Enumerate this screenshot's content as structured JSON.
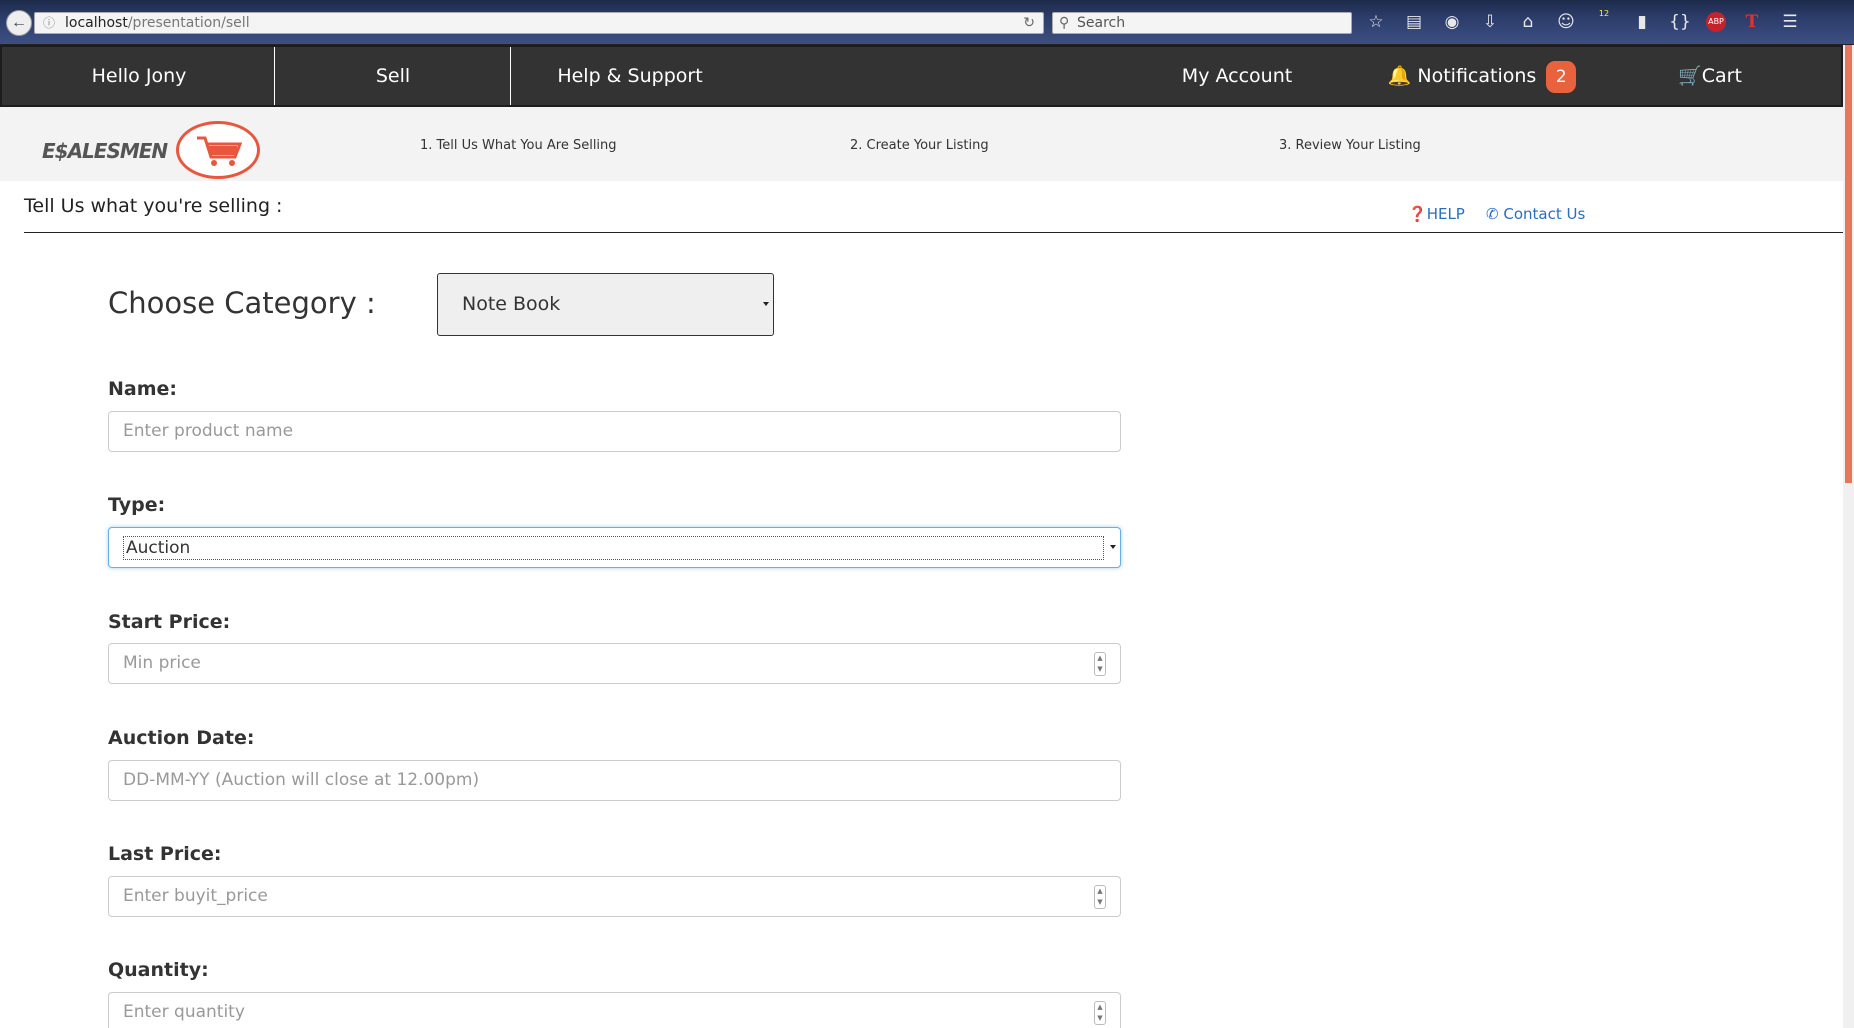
{
  "browser": {
    "url_host": "localhost",
    "url_path": "/presentation/sell",
    "search_placeholder": "Search",
    "addon_badge": "12",
    "abp_label": "ABP"
  },
  "nav": {
    "greeting": "Hello Jony",
    "sell": "Sell",
    "help_support": "Help & Support",
    "my_account": "My Account",
    "notifications": "Notifications",
    "notifications_count": "2",
    "cart": "Cart"
  },
  "brand": {
    "logo_text": "E$ALESMEN",
    "accent_color": "#e8563e"
  },
  "steps": [
    "1. Tell Us What You Are Selling",
    "2. Create Your Listing",
    "3. Review Your Listing"
  ],
  "page": {
    "heading": "Tell Us what you're selling :",
    "help": "HELP",
    "contact": "Contact Us"
  },
  "form": {
    "category_label": "Choose Category :",
    "category_value": "Note Book",
    "name_label": "Name:",
    "name_placeholder": "Enter product name",
    "type_label": "Type:",
    "type_value": "Auction",
    "start_price_label": "Start Price:",
    "start_price_placeholder": "Min price",
    "auction_date_label": "Auction Date:",
    "auction_date_placeholder": "DD-MM-YY (Auction will close at 12.00pm)",
    "last_price_label": "Last Price:",
    "last_price_placeholder": "Enter buyit_price",
    "quantity_label": "Quantity:",
    "quantity_placeholder": "Enter quantity"
  }
}
